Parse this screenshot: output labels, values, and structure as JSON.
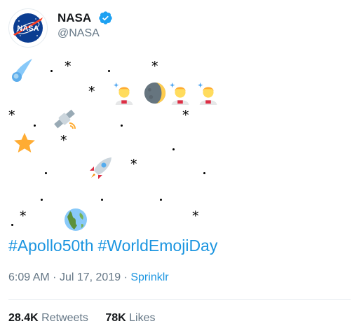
{
  "tweet": {
    "display_name": "NASA",
    "handle": "@NASA",
    "avatar_text": "NASA",
    "verified": true,
    "emoji_art": [
      "comet",
      "astronaut",
      "moon",
      "astronaut",
      "astronaut",
      "satellite",
      "star",
      "rocket",
      "earth"
    ],
    "hashtags": [
      "#Apollo50th",
      "#WorldEmojiDay"
    ],
    "time": "6:09 AM",
    "separator": "·",
    "date": "Jul 17, 2019",
    "source": "Sprinklr",
    "retweets_count": "28.4K",
    "retweets_label": "Retweets",
    "likes_count": "78K",
    "likes_label": "Likes"
  },
  "colors": {
    "link": "#1b95e0",
    "secondary": "#657786",
    "nasa_blue": "#0b3d91",
    "nasa_red": "#fc3d21"
  },
  "icons": [
    "nasa-logo",
    "verified-badge-icon",
    "comet-icon",
    "astronaut-icon",
    "moon-icon",
    "satellite-icon",
    "star-icon",
    "rocket-icon",
    "earth-icon"
  ]
}
